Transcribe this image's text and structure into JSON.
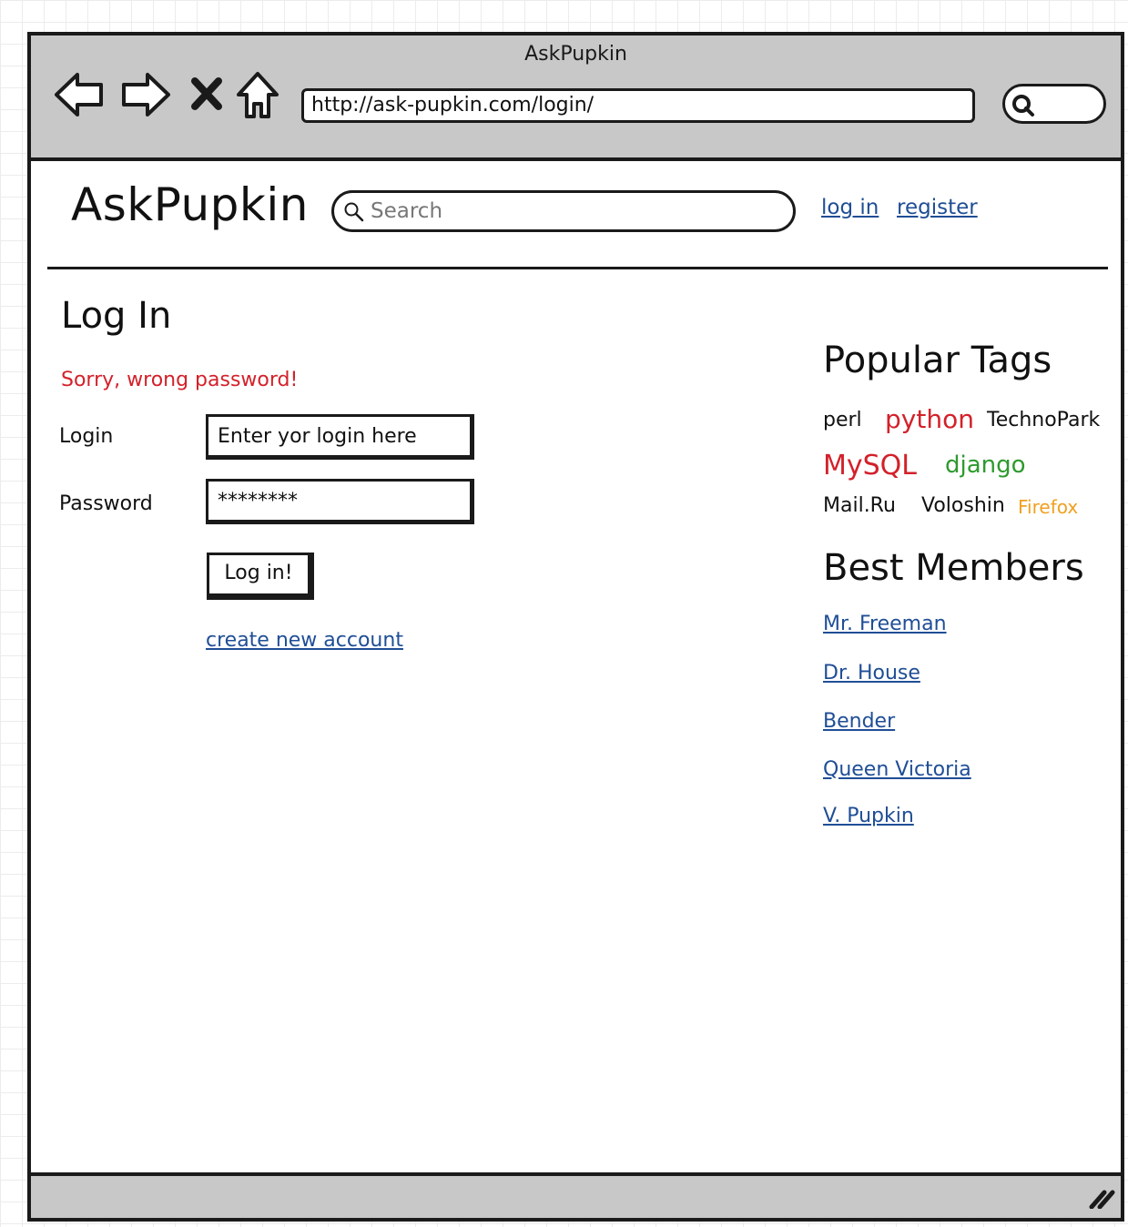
{
  "browser": {
    "window_title": "AskPupkin",
    "url": "http://ask-pupkin.com/login/",
    "icons": [
      "back-icon",
      "forward-icon",
      "close-icon",
      "home-icon",
      "search-icon"
    ]
  },
  "header": {
    "site_title": "AskPupkin",
    "search_placeholder": "Search",
    "login_link": "log in",
    "register_link": "register"
  },
  "login": {
    "heading": "Log In",
    "error": "Sorry, wrong password!",
    "login_label": "Login",
    "login_value": "Enter yor login here",
    "password_label": "Password",
    "password_value": "********",
    "submit": "Log in!",
    "create_account": "create new account"
  },
  "sidebar": {
    "tags_heading": "Popular Tags",
    "tags": [
      {
        "label": "perl",
        "color": "#111111"
      },
      {
        "label": "python",
        "color": "#d3212a"
      },
      {
        "label": "TechnoPark",
        "color": "#111111"
      },
      {
        "label": "MySQL",
        "color": "#d3212a"
      },
      {
        "label": "django",
        "color": "#2e9a2e"
      },
      {
        "label": "Mail.Ru",
        "color": "#111111"
      },
      {
        "label": "Voloshin",
        "color": "#111111"
      },
      {
        "label": "Firefox",
        "color": "#f0a020"
      }
    ],
    "members_heading": "Best Members",
    "members": [
      "Mr. Freeman",
      "Dr. House",
      "Bender",
      "Queen Victoria",
      "V. Pupkin"
    ]
  },
  "colors": {
    "chrome": "#c8c8c8",
    "link": "#1f4e96",
    "error": "#d3212a"
  }
}
